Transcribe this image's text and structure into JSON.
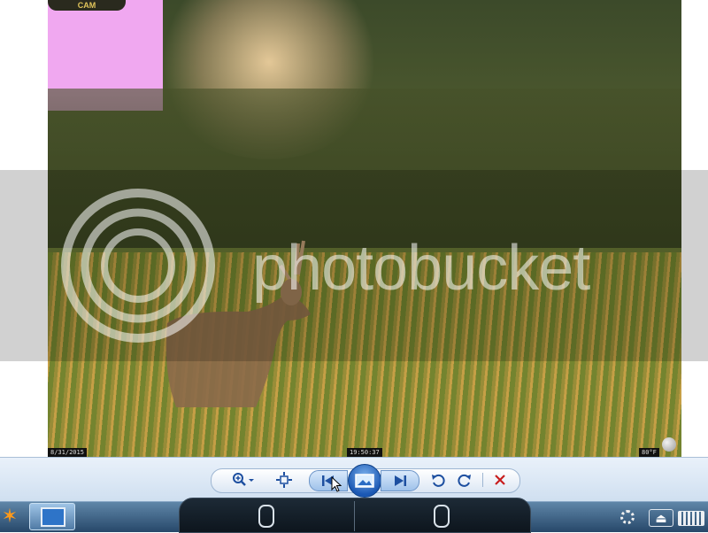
{
  "photo": {
    "brand": "CAM",
    "date_stamp": "8/31/2015",
    "time_stamp": "19:50:37",
    "temp_stamp": "80°F"
  },
  "watermark": {
    "text": "photobucket"
  },
  "toolbar": {
    "zoom_icon": "magnifier-plus-icon",
    "fit_icon": "fit-to-window-icon",
    "prev_icon": "previous-icon",
    "slideshow_icon": "slideshow-icon",
    "next_icon": "next-icon",
    "rotate_ccw_icon": "rotate-counterclockwise-icon",
    "rotate_cw_icon": "rotate-clockwise-icon",
    "delete_icon": "delete-icon"
  },
  "taskbar": {
    "start_icon": "start-icon",
    "app_icon": "photo-viewer-icon",
    "tray": [
      "settings-icon",
      "eject-icon",
      "keyboard-icon"
    ],
    "remote_panel_icons": [
      "mouse-left-icon",
      "mouse-right-icon"
    ]
  },
  "colors": {
    "accent": "#1d4fa0",
    "delete": "#c81d1d",
    "taskbar": "#27486a",
    "sky": "#f0a8f0"
  }
}
